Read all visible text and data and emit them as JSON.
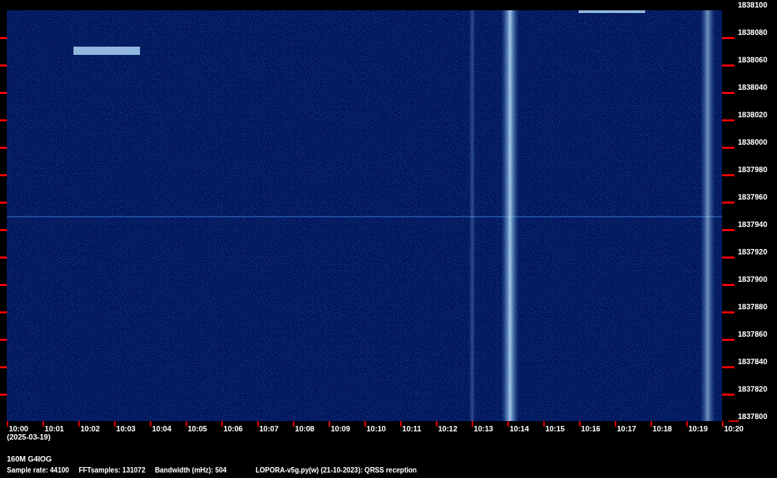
{
  "frequency_axis": {
    "labels": [
      "1838100",
      "1838080",
      "1838060",
      "1838040",
      "1838020",
      "1838000",
      "1837980",
      "1837960",
      "1837940",
      "1837920",
      "1837900",
      "1837880",
      "1837860",
      "1837840",
      "1837820",
      "1837800"
    ]
  },
  "time_axis": {
    "labels": [
      "10:00",
      "10:01",
      "10:02",
      "10:03",
      "10:04",
      "10:05",
      "10:06",
      "10:07",
      "10:08",
      "10:09",
      "10:10",
      "10:11",
      "10:12",
      "10:13",
      "10:14",
      "10:15",
      "10:16",
      "10:17",
      "10:18",
      "10:19",
      "10:20"
    ]
  },
  "date": "(2025-03-19)",
  "station": "160M G4IOG",
  "info": [
    {
      "text": "Sample rate: 44100"
    },
    {
      "text": "FFTsamples: 131072"
    },
    {
      "text": "Bandwidth (mHz): 504"
    },
    {
      "text": "LOPORA-v5g.py(w) (21-10-2023): QRSS reception"
    }
  ]
}
